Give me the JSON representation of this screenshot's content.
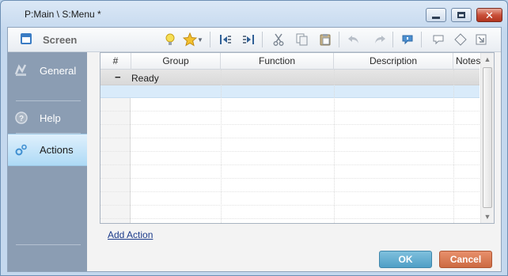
{
  "window": {
    "title": "P:Main \\ S:Menu *"
  },
  "toolbar": {
    "screen_label": "Screen",
    "icons": [
      "lightbulb-icon",
      "star-icon",
      "outdent-icon",
      "indent-icon",
      "cut-icon",
      "copy-icon",
      "paste-icon",
      "undo-icon",
      "redo-icon",
      "comment-icon",
      "speech-bubble-icon",
      "tag-icon",
      "export-icon"
    ]
  },
  "sidebar": {
    "items": [
      {
        "label": "General",
        "icon": "general-icon"
      },
      {
        "label": "Help",
        "icon": "help-icon"
      },
      {
        "label": "Actions",
        "icon": "gears-icon",
        "active": true
      }
    ]
  },
  "grid": {
    "columns": [
      "#",
      "Group",
      "Function",
      "Description",
      "Notes"
    ],
    "group_row": {
      "label": "Ready",
      "collapse": "−"
    }
  },
  "actions": {
    "add_action": "Add Action",
    "ok": "OK",
    "cancel": "Cancel"
  },
  "colors": {
    "ok": "#5aa9cf",
    "cancel": "#d8764d",
    "nav_bg": "#8b9db3",
    "active_nav": "#bfe3f9"
  }
}
